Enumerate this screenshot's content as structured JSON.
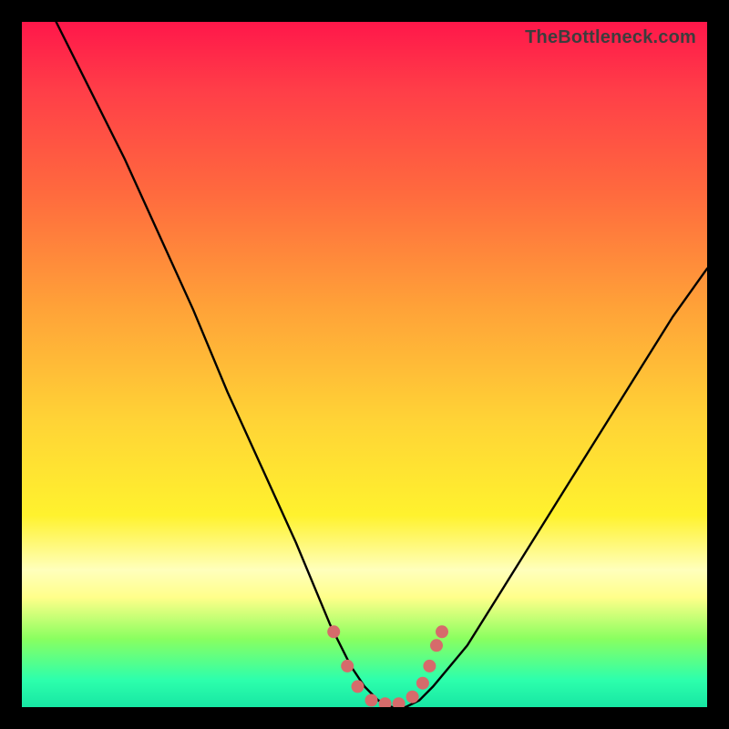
{
  "watermark": "TheBottleneck.com",
  "chart_data": {
    "type": "line",
    "title": "",
    "xlabel": "",
    "ylabel": "",
    "xlim": [
      0,
      100
    ],
    "ylim": [
      0,
      100
    ],
    "series": [
      {
        "name": "bottleneck-curve",
        "x": [
          5,
          10,
          15,
          20,
          25,
          30,
          35,
          40,
          45,
          48,
          50,
          52,
          54,
          56,
          58,
          60,
          65,
          70,
          75,
          80,
          85,
          90,
          95,
          100
        ],
        "y": [
          100,
          90,
          80,
          69,
          58,
          46,
          35,
          24,
          12,
          6,
          3,
          1,
          0,
          0,
          1,
          3,
          9,
          17,
          25,
          33,
          41,
          49,
          57,
          64
        ]
      }
    ],
    "markers": [
      {
        "x": 45.5,
        "y": 11
      },
      {
        "x": 47.5,
        "y": 6
      },
      {
        "x": 49,
        "y": 3
      },
      {
        "x": 51,
        "y": 1
      },
      {
        "x": 53,
        "y": 0.5
      },
      {
        "x": 55,
        "y": 0.5
      },
      {
        "x": 57,
        "y": 1.5
      },
      {
        "x": 58.5,
        "y": 3.5
      },
      {
        "x": 59.5,
        "y": 6
      },
      {
        "x": 60.5,
        "y": 9
      },
      {
        "x": 61.3,
        "y": 11
      }
    ],
    "marker_color": "#d66b6b",
    "curve_color": "#000000",
    "background_gradient": [
      "#ff174a",
      "#ff6a3e",
      "#ffd336",
      "#ffffbc",
      "#2dffac"
    ]
  }
}
